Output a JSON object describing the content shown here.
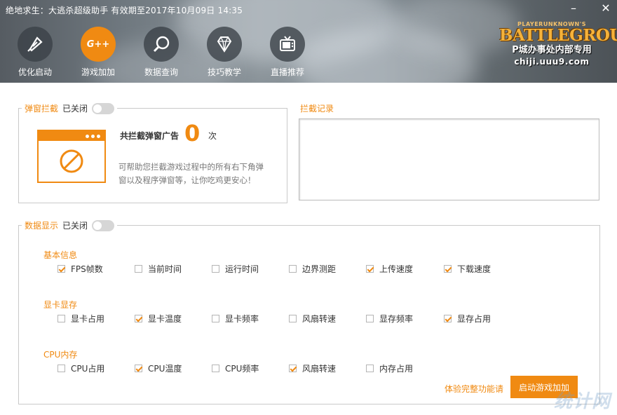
{
  "window": {
    "title": "绝地求生：大逃杀超级助手 有效期至2017年10月09日 14:35",
    "minimize_glyph": "–",
    "close_glyph": "✕"
  },
  "nav": {
    "items": [
      {
        "label": "优化启动",
        "icon": "rocket-icon"
      },
      {
        "label": "游戏加加",
        "icon": "gplus-logo-icon",
        "active": true,
        "logo_text": "G++"
      },
      {
        "label": "数据查询",
        "icon": "search-icon"
      },
      {
        "label": "技巧教学",
        "icon": "diamond-icon"
      },
      {
        "label": "直播推荐",
        "icon": "tv-icon"
      }
    ]
  },
  "logo": {
    "small": "PLAYERUNKNOWN'S",
    "main": "BATTLEGROUNDS",
    "sub": "P城办事处内部专用",
    "url": "chiji.uuu9.com"
  },
  "popup_block": {
    "title": "弹窗拦截",
    "state": "已关闭",
    "count_label": "共拦截弹窗广告",
    "count": "0",
    "count_unit": "次",
    "description": "可帮助您拦截游戏过程中的所有右下角弹窗以及程序弹窗等，让你吃鸡更安心！"
  },
  "records": {
    "title": "拦截记录"
  },
  "data_display": {
    "title": "数据显示",
    "state": "已关闭",
    "groups": [
      {
        "title": "基本信息",
        "options": [
          {
            "label": "FPS帧数",
            "checked": true
          },
          {
            "label": "当前时间",
            "checked": false
          },
          {
            "label": "运行时间",
            "checked": false
          },
          {
            "label": "边界测距",
            "checked": false
          },
          {
            "label": "上传速度",
            "checked": true
          },
          {
            "label": "下载速度",
            "checked": true
          }
        ]
      },
      {
        "title": "显卡显存",
        "options": [
          {
            "label": "显卡占用",
            "checked": false
          },
          {
            "label": "显卡温度",
            "checked": true
          },
          {
            "label": "显卡频率",
            "checked": false
          },
          {
            "label": "风扇转速",
            "checked": false
          },
          {
            "label": "显存频率",
            "checked": false
          },
          {
            "label": "显存占用",
            "checked": true
          }
        ]
      },
      {
        "title": "CPU内存",
        "options": [
          {
            "label": "CPU占用",
            "checked": false
          },
          {
            "label": "CPU温度",
            "checked": true
          },
          {
            "label": "CPU频率",
            "checked": false
          },
          {
            "label": "风扇转速",
            "checked": true
          },
          {
            "label": "内存占用",
            "checked": false
          }
        ]
      }
    ],
    "full_features_link": "体验完整功能请",
    "start_button": "启动游戏加加"
  },
  "watermark": "统计网",
  "colors": {
    "accent": "#f08a12",
    "header_dark": "#4c5257"
  }
}
